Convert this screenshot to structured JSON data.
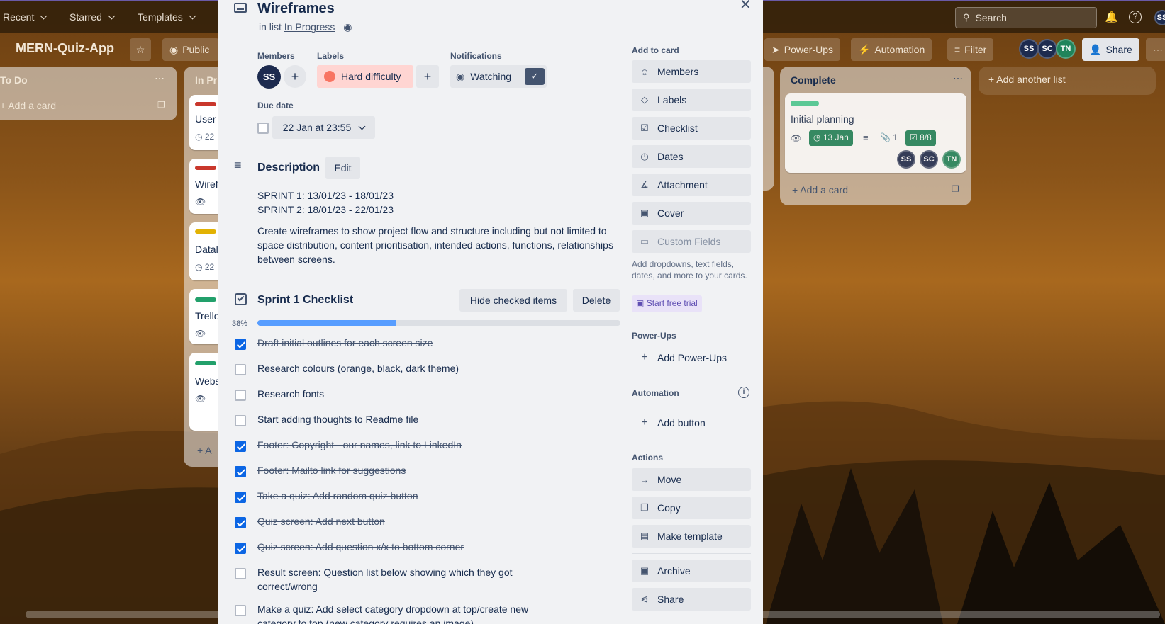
{
  "topbar": {
    "nav": [
      "Recent",
      "Starred",
      "Templates"
    ],
    "search_placeholder": "Search",
    "user_initials": "SS"
  },
  "board": {
    "title": "MERN-Quiz-App",
    "visibility": "Public",
    "buttons": {
      "powerups": "Power-Ups",
      "automation": "Automation",
      "filter": "Filter",
      "share": "Share"
    },
    "members": [
      {
        "initials": "SS",
        "color": "#1d2b4f"
      },
      {
        "initials": "SC",
        "color": "#1d2b4f"
      },
      {
        "initials": "TN",
        "color": "#1f845a"
      }
    ],
    "lists": {
      "todo": {
        "title": "To Do",
        "add_card": "Add a card"
      },
      "inprogress": {
        "title": "In Pr",
        "cards": [
          "User",
          "Wiref",
          "Datal",
          "Trello",
          "Webs"
        ],
        "dates": [
          "22",
          "22"
        ],
        "add": "+ A"
      },
      "complete": {
        "title": "Complete",
        "card_title": "Initial planning",
        "card_date": "13 Jan",
        "card_attach": "1",
        "card_checklist": "8/8",
        "add_card": "Add a card"
      },
      "add_list": "Add another list"
    }
  },
  "modal": {
    "title": "Wireframes",
    "in_list_prefix": "in list",
    "in_list_link": "In Progress",
    "members_label": "Members",
    "member_initials": "SS",
    "labels_label": "Labels",
    "label_text": "Hard difficulty",
    "label_color": "#f87462",
    "notifications_label": "Notifications",
    "watching": "Watching",
    "due_label": "Due date",
    "due_value": "22 Jan at 23:55",
    "description_title": "Description",
    "edit": "Edit",
    "description_lines": [
      "SPRINT 1: 13/01/23 - 18/01/23",
      "SPRINT 2: 18/01/23 - 22/01/23"
    ],
    "description_para": "Create wireframes to show project flow and structure including but not limited to space distribution, content prioritisation, intended actions, functions, relationships between screens.",
    "checklist_title": "Sprint 1 Checklist",
    "hide_checked": "Hide checked items",
    "delete": "Delete",
    "progress_label": "38%",
    "progress_value": 38,
    "items": [
      {
        "text": "Draft initial outlines for each screen size",
        "done": true
      },
      {
        "text": "Research colours (orange, black, dark theme)",
        "done": false
      },
      {
        "text": "Research fonts",
        "done": false
      },
      {
        "text": "Start adding thoughts to Readme file",
        "done": false
      },
      {
        "text": "Footer: Copyright - our names, link to LinkedIn",
        "done": true
      },
      {
        "text": "Footer: Mailto link for suggestions",
        "done": true
      },
      {
        "text": "Take a quiz: Add random quiz button",
        "done": true
      },
      {
        "text": "Quiz screen: Add next button",
        "done": true
      },
      {
        "text": "Quiz screen: Add question x/x to bottom corner",
        "done": true
      },
      {
        "text": "Result screen: Question list below showing which they got correct/wrong",
        "done": false
      },
      {
        "text": "Make a quiz: Add select category dropdown at top/create new category to top (new category requires an image)",
        "done": false
      }
    ],
    "sidebar": {
      "add_to_card": "Add to card",
      "buttons": [
        "Members",
        "Labels",
        "Checklist",
        "Dates",
        "Attachment",
        "Cover",
        "Custom Fields"
      ],
      "custom_fields_hint": "Add dropdowns, text fields, dates, and more to your cards.",
      "start_trial": "Start free trial",
      "powerups_title": "Power-Ups",
      "add_powerups": "Add Power-Ups",
      "automation_title": "Automation",
      "add_button": "Add button",
      "actions_title": "Actions",
      "actions": [
        "Move",
        "Copy",
        "Make template",
        "Archive",
        "Share"
      ]
    }
  }
}
